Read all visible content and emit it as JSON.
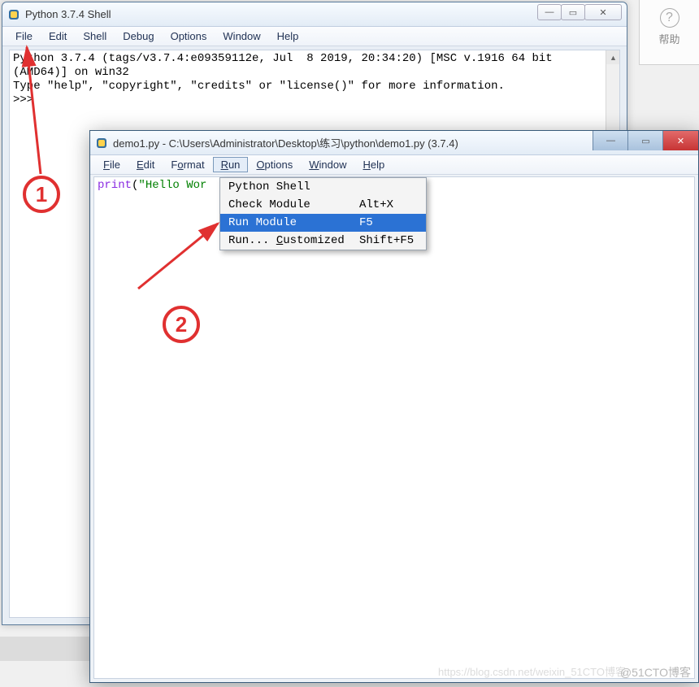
{
  "help_panel": {
    "label": "帮助"
  },
  "shell_window": {
    "title": "Python 3.7.4 Shell",
    "menubar": [
      "File",
      "Edit",
      "Shell",
      "Debug",
      "Options",
      "Window",
      "Help"
    ],
    "banner_line1": "Python 3.7.4 (tags/v3.7.4:e09359112e, Jul  8 2019, 20:34:20) [MSC v.1916 64 bit",
    "banner_line2": "(AMD64)] on win32",
    "banner_line3": "Type \"help\", \"copyright\", \"credits\" or \"license()\" for more information.",
    "prompt": ">>>"
  },
  "editor_window": {
    "title": "demo1.py - C:\\Users\\Administrator\\Desktop\\练习\\python\\demo1.py (3.7.4)",
    "menubar": [
      "File",
      "Edit",
      "Format",
      "Run",
      "Options",
      "Window",
      "Help"
    ],
    "active_menu_index": 3,
    "code": {
      "builtin": "print",
      "paren_open": "(",
      "string": "\"Hello Wor"
    }
  },
  "run_menu": {
    "items": [
      {
        "label": "Python Shell",
        "shortcut": ""
      },
      {
        "label": "Check Module",
        "shortcut": "Alt+X"
      },
      {
        "label": "Run Module",
        "shortcut": "F5",
        "selected": true
      },
      {
        "label": "Run... Customized",
        "shortcut": "Shift+F5"
      }
    ]
  },
  "annotations": {
    "circle1": "1",
    "circle2": "2"
  },
  "watermark_faint": "https://blog.csdn.net/weixin_51CTO博客",
  "watermark": "@51CTO博客"
}
